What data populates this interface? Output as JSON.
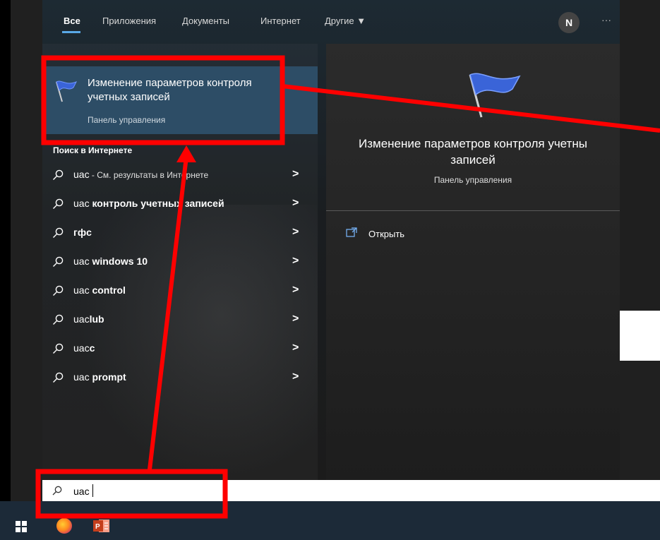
{
  "tabs": {
    "all": "Все",
    "apps": "Приложения",
    "documents": "Документы",
    "web": "Интернет",
    "other": "Другие ▼"
  },
  "user": {
    "avatar_letter": "N",
    "more": "···"
  },
  "best_match": {
    "title": "Изменение параметров контроля учетных записей",
    "subtitle": "Панель управления"
  },
  "web_section": {
    "header": "Поиск в Интернете"
  },
  "suggestions": [
    {
      "prefix": "uac",
      "rest": " - См. результаты в Интернете"
    },
    {
      "prefix": "uac ",
      "rest": "контроль учетных записей"
    },
    {
      "prefix": "",
      "rest": "гфс"
    },
    {
      "prefix": "uac ",
      "rest": "windows 10"
    },
    {
      "prefix": "uac ",
      "rest": "control"
    },
    {
      "prefix": "uac",
      "rest": "lub"
    },
    {
      "prefix": "uac",
      "rest": "c"
    },
    {
      "prefix": "uac ",
      "rest": "prompt"
    }
  ],
  "preview": {
    "title_line1": "Изменение параметров контроля учетны",
    "title_line2": "записей",
    "subtitle": "Панель управления",
    "open_label": "Открыть"
  },
  "search": {
    "value": "uac"
  },
  "colors": {
    "highlight": "#2d4d66",
    "annotation_red": "#ff0000",
    "accent": "#5aa9e6"
  },
  "icons": {
    "flag": "uac-flag-icon",
    "search": "search-icon",
    "arrow": "chevron-right-icon",
    "open": "open-icon",
    "windows": "windows-start-icon",
    "firefox": "firefox-icon",
    "powerpoint": "powerpoint-icon"
  }
}
